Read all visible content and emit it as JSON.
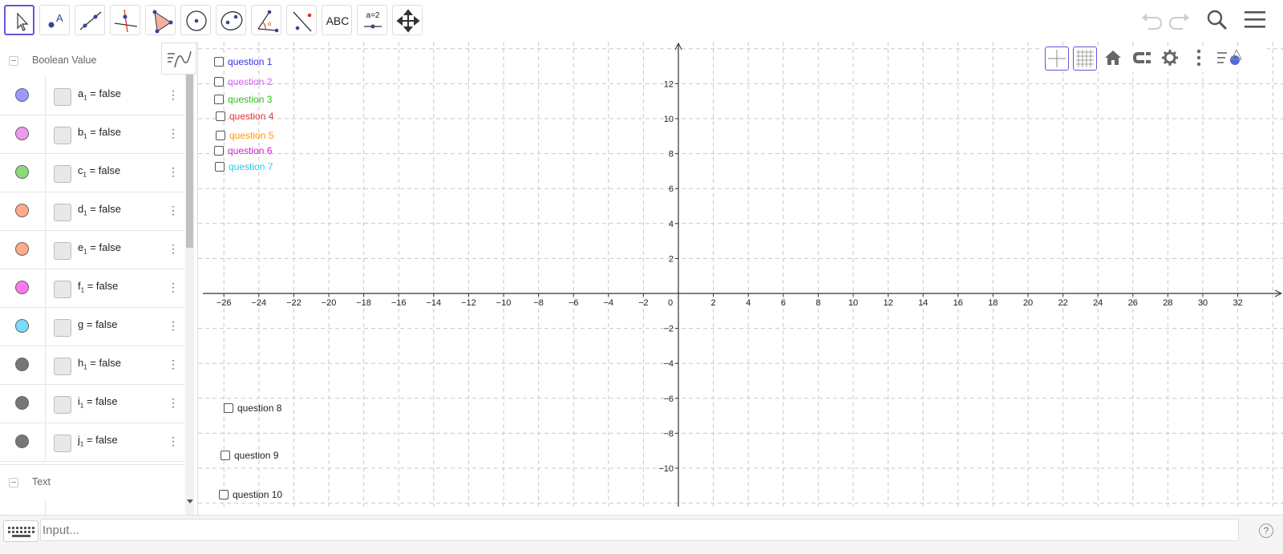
{
  "toolbar": {
    "tools": [
      {
        "name": "move-tool",
        "label": ""
      },
      {
        "name": "point-tool",
        "label": ""
      },
      {
        "name": "line-tool",
        "label": ""
      },
      {
        "name": "perpendicular-line-tool",
        "label": ""
      },
      {
        "name": "polygon-tool",
        "label": ""
      },
      {
        "name": "circle-center-point-tool",
        "label": ""
      },
      {
        "name": "ellipse-tool",
        "label": ""
      },
      {
        "name": "angle-tool",
        "label": ""
      },
      {
        "name": "reflect-tool",
        "label": ""
      },
      {
        "name": "text-tool",
        "label": "ABC"
      },
      {
        "name": "slider-tool",
        "label": "a=2"
      },
      {
        "name": "move-graphics-view-tool",
        "label": ""
      }
    ],
    "right_icons": [
      "undo-icon",
      "redo-icon",
      "search-icon",
      "menu-icon"
    ]
  },
  "algebra": {
    "groups": [
      {
        "title": "Boolean Value"
      },
      {
        "title": "Text"
      }
    ],
    "rows": [
      {
        "name": "a",
        "sub": "1",
        "value": "false",
        "color": "#9999ff"
      },
      {
        "name": "b",
        "sub": "1",
        "value": "false",
        "color": "#ee99ee"
      },
      {
        "name": "c",
        "sub": "1",
        "value": "false",
        "color": "#88dd77"
      },
      {
        "name": "d",
        "sub": "1",
        "value": "false",
        "color": "#ffaa88"
      },
      {
        "name": "e",
        "sub": "1",
        "value": "false",
        "color": "#ffaa88"
      },
      {
        "name": "f",
        "sub": "1",
        "value": "false",
        "color": "#ff77ee"
      },
      {
        "name": "g",
        "sub": "",
        "value": "false",
        "color": "#77ddff"
      },
      {
        "name": "h",
        "sub": "1",
        "value": "false",
        "color": "#777777"
      },
      {
        "name": "i",
        "sub": "1",
        "value": "false",
        "color": "#777777"
      },
      {
        "name": "j",
        "sub": "1",
        "value": "false",
        "color": "#777777"
      }
    ]
  },
  "graphics": {
    "x_ticks": [
      -26,
      -24,
      -22,
      -20,
      -18,
      -16,
      -14,
      -12,
      -10,
      -8,
      -6,
      -4,
      -2,
      0,
      2,
      4,
      6,
      8,
      10,
      12,
      14,
      16,
      18,
      20,
      22,
      24,
      26,
      28,
      30,
      32
    ],
    "y_ticks": [
      12,
      10,
      8,
      6,
      4,
      2,
      -2,
      -4,
      -6,
      -8,
      -10
    ],
    "style_bar_icons": [
      "axes-icon",
      "grid-icon",
      "home-icon",
      "magnet-icon",
      "gear-icon",
      "more-icon",
      "style-bar-toggle-icon"
    ],
    "checkboxes": [
      {
        "label": "question 1",
        "color": "#3333dd"
      },
      {
        "label": "question 2",
        "color": "#cc66ee"
      },
      {
        "label": "question 3",
        "color": "#33bb22"
      },
      {
        "label": "question 4",
        "color": "#ee3333"
      },
      {
        "label": "question 5",
        "color": "#ff9900"
      },
      {
        "label": "question 6",
        "color": "#cc22cc"
      },
      {
        "label": "question 7",
        "color": "#22ccee"
      },
      {
        "label": "question 8",
        "color": "#222222"
      },
      {
        "label": "question 9",
        "color": "#222222"
      },
      {
        "label": "question 10",
        "color": "#222222"
      }
    ]
  },
  "input": {
    "placeholder": "Input..."
  },
  "help": {
    "label": "?"
  }
}
